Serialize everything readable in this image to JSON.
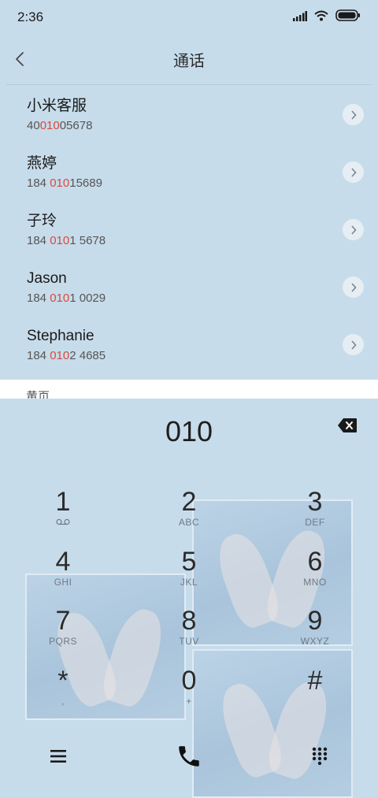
{
  "status": {
    "time": "2:36"
  },
  "header": {
    "title": "通话"
  },
  "contacts": [
    {
      "name": "小米客服",
      "num_pre": "40",
      "num_hl": "010",
      "num_post": "05678"
    },
    {
      "name": "燕婷",
      "num_pre": "184 ",
      "num_hl": "010",
      "num_post": "15689"
    },
    {
      "name": "子玲",
      "num_pre": "184 ",
      "num_hl": "010",
      "num_post": "1 5678"
    },
    {
      "name": "Jason",
      "num_pre": "184 ",
      "num_hl": "010",
      "num_post": "1 0029"
    },
    {
      "name": "Stephanie",
      "num_pre": "184 ",
      "num_hl": "010",
      "num_post": "2 4685"
    }
  ],
  "section_label": "黄页",
  "dialer": {
    "input": "010",
    "keys": [
      {
        "digit": "1",
        "letters": ""
      },
      {
        "digit": "2",
        "letters": "ABC"
      },
      {
        "digit": "3",
        "letters": "DEF"
      },
      {
        "digit": "4",
        "letters": "GHI"
      },
      {
        "digit": "5",
        "letters": "JKL"
      },
      {
        "digit": "6",
        "letters": "MNO"
      },
      {
        "digit": "7",
        "letters": "PQRS"
      },
      {
        "digit": "8",
        "letters": "TUV"
      },
      {
        "digit": "9",
        "letters": "WXYZ"
      },
      {
        "digit": "*",
        "letters": ","
      },
      {
        "digit": "0",
        "letters": "+"
      },
      {
        "digit": "#",
        "letters": ""
      }
    ]
  },
  "colors": {
    "background": "#c7dceb",
    "highlight": "#d9493c"
  },
  "icons": [
    "signal-icon",
    "wifi-icon",
    "battery-icon",
    "back-arrow-icon",
    "chevron-right-icon",
    "backspace-icon",
    "voicemail-icon",
    "menu-icon",
    "phone-icon",
    "keypad-icon"
  ]
}
